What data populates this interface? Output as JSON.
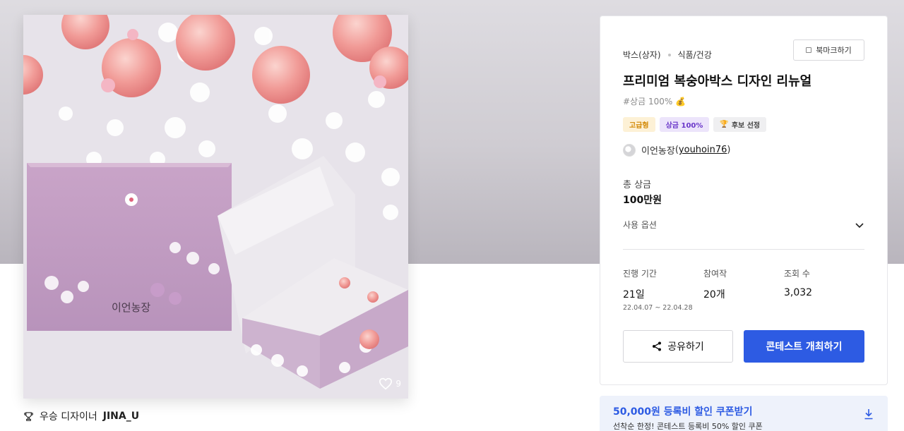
{
  "colors": {
    "accent": "#2d5be3",
    "gold": "#d38a07",
    "purple": "#6a37c9"
  },
  "artwork": {
    "likes": "9",
    "brand_text": "이언농장"
  },
  "winner": {
    "prefix": "우승 디자이너",
    "name": "JINA_U"
  },
  "panel": {
    "category": "박스(상자)",
    "subcategory": "식품/건강",
    "bookmark_label": "북마크하기",
    "title": "프리미엄 복숭아박스 디자인 리뉴얼",
    "hashtag": "#상금 100% 💰",
    "badges": [
      "고급형",
      "상금 100%",
      "후보 선정"
    ],
    "host_name": "이언농장",
    "host_id": "youhoin76",
    "prize_label": "총 상금",
    "prize_value": "100만원",
    "usage_label": "사용 옵션",
    "stats": {
      "period_label": "진행 기간",
      "period_value": "21일",
      "period_dates": "22.04.07 ~ 22.04.28",
      "participants_label": "참여작",
      "participants_value": "20개",
      "views_label": "조회 수",
      "views_value": "3,032"
    },
    "share_label": "공유하기",
    "host_button_label": "콘테스트 개최하기"
  },
  "coupon": {
    "title": "50,000원 등록비 할인 쿠폰받기",
    "subtitle": "선착순 한정! 콘테스트 등록비 50% 할인 쿠폰"
  }
}
